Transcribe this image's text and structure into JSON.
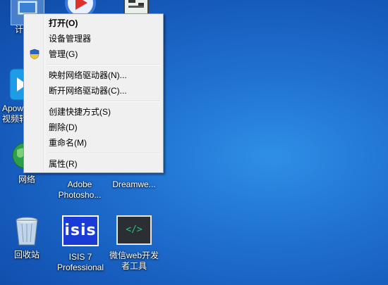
{
  "desktop": {
    "icons": [
      {
        "label": "计算机"
      },
      {
        "label": ""
      },
      {
        "label": ""
      },
      {
        "label": "Apowersoft 视频转换"
      },
      {
        "label": "网络"
      },
      {
        "label": "Adobe Photosho..."
      },
      {
        "label": "Dreamwe..."
      },
      {
        "label": "回收站"
      },
      {
        "label": "ISIS 7 Professional"
      },
      {
        "label": "微信web开发者工具"
      }
    ],
    "isis_logo_text": "isis",
    "wechat_dev_symbol": "</>"
  },
  "context_menu": {
    "items": [
      {
        "label": "打开(O)",
        "bold": true
      },
      {
        "label": "设备管理器"
      },
      {
        "label": "管理(G)",
        "icon": "shield-icon"
      },
      {
        "label": "映射网络驱动器(N)..."
      },
      {
        "label": "断开网络驱动器(C)..."
      },
      {
        "label": "创建快捷方式(S)"
      },
      {
        "label": "删除(D)"
      },
      {
        "label": "重命名(M)"
      },
      {
        "label": "属性(R)"
      }
    ]
  },
  "colors": {
    "desktop_background": "#1f6fcf",
    "menu_background": "#f0f0f0",
    "shield_blue": "#2a64c5",
    "shield_yellow": "#f2c230",
    "isis_blue": "#1a3bd6",
    "wechat_green": "#2ec27e"
  }
}
